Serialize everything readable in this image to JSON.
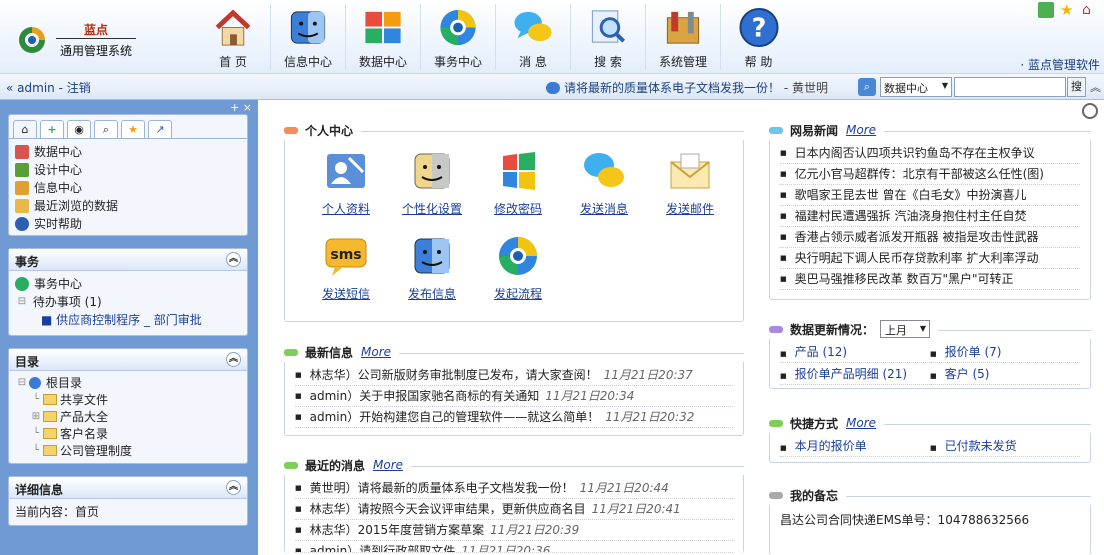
{
  "brand": {
    "sub": "蓝点",
    "name": "通用管理系统",
    "link": "· 蓝点管理软件"
  },
  "nav": [
    {
      "label": "首 页",
      "icon": "home-icon"
    },
    {
      "label": "信息中心",
      "icon": "finder-icon"
    },
    {
      "label": "数据中心",
      "icon": "blocks-icon"
    },
    {
      "label": "事务中心",
      "icon": "browser-icon"
    },
    {
      "label": "消 息",
      "icon": "chat-icon"
    },
    {
      "label": "搜 索",
      "icon": "search-doc-icon"
    },
    {
      "label": "系统管理",
      "icon": "tools-icon"
    },
    {
      "label": "帮 助",
      "icon": "help-icon"
    }
  ],
  "infobar": {
    "user": "« admin - 注销",
    "ticker": "请将最新的质量体系电子文档发我一份！",
    "ticker_sender": "- 黄世明",
    "quick_select": "数据中心",
    "search_button": "搜"
  },
  "sidebar": {
    "tools": "+ ×",
    "tabs": [
      "⌂",
      "+",
      "◉",
      "⌕",
      "★",
      "↗"
    ],
    "favorites": [
      {
        "label": "数据中心",
        "color": "#d9534f"
      },
      {
        "label": "设计中心",
        "color": "#5a9e3a"
      },
      {
        "label": "信息中心",
        "color": "#e0a030"
      },
      {
        "label": "最近浏览的数据",
        "color": "#e8b84a"
      },
      {
        "label": "实时帮助",
        "color": "#2a5fb5"
      }
    ],
    "affairs": {
      "title": "事务",
      "center": "事务中心",
      "pending": "待办事项 (1)",
      "pending_item": "■ 供应商控制程序 _ 部门审批"
    },
    "catalog": {
      "title": "目录",
      "root": "根目录",
      "items": [
        "共享文件",
        "产品大全",
        "客户名录",
        "公司管理制度"
      ]
    },
    "detail": {
      "title": "详细信息",
      "content": "当前内容：首页"
    }
  },
  "personal": {
    "title": "个人中心",
    "items": [
      "个人资料",
      "个性化设置",
      "修改密码",
      "发送消息",
      "发送邮件",
      "发送短信",
      "发布信息",
      "发起流程"
    ]
  },
  "latest_info": {
    "title": "最新信息",
    "more": "More",
    "items": [
      {
        "text": "林志华）公司新版财务审批制度已发布，请大家查阅！",
        "time": "11月21日20:37"
      },
      {
        "text": "admin）关于申报国家驰名商标的有关通知",
        "time": "11月21日20:34"
      },
      {
        "text": "admin）开始构建您自己的管理软件——就这么简单！",
        "time": "11月21日20:32"
      }
    ]
  },
  "recent_msgs": {
    "title": "最近的消息",
    "more": "More",
    "items": [
      {
        "text": "黄世明）请将最新的质量体系电子文档发我一份！",
        "time": "11月21日20:44"
      },
      {
        "text": "林志华）请按照今天会议评审结果，更新供应商名目",
        "time": "11月21日20:41"
      },
      {
        "text": "林志华）2015年度营销方案草案",
        "time": "11月21日20:39"
      },
      {
        "text": "admin）请到行政部取文件",
        "time": "11月21日20:36"
      }
    ]
  },
  "news": {
    "title": "网易新闻",
    "more": "More",
    "items": [
      "日本内阁否认四项共识钓鱼岛不存在主权争议",
      "亿元小官马超群传：北京有干部被这么任性(图)",
      "歌唱家王昆去世 曾在《白毛女》中扮演喜儿",
      "福建村民遭遇强拆 汽油浇身抱住村主任自焚",
      "香港占领示威者派发开瓶器 被指是攻击性武器",
      "央行明起下调人民币存贷款利率 扩大利率浮动",
      "奥巴马强推移民改革 数百万\"黑户\"可转正"
    ]
  },
  "data_update": {
    "title": "数据更新情况：",
    "period": "上月",
    "items": [
      "产品 (12)",
      "报价单 (7)",
      "报价单产品明细 (21)",
      "客户 (5)"
    ]
  },
  "shortcuts": {
    "title": "快捷方式",
    "more": "More",
    "items": [
      "本月的报价单",
      "已付款未发货"
    ]
  },
  "memo": {
    "title": "我的备忘",
    "text": "昌达公司合同快递EMS单号：104788632566"
  }
}
